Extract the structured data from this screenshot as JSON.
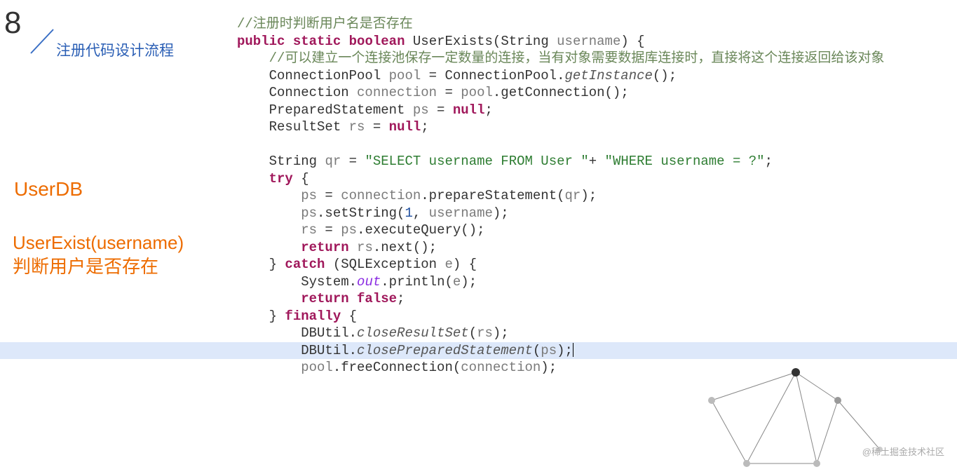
{
  "slide": {
    "number": "8",
    "title": "注册代码设计流程"
  },
  "sidebar": {
    "label1": "UserDB",
    "label2_line1": "UserExist(username)",
    "label2_line2": "判断用户是否存在"
  },
  "code": {
    "l1_cm": "//注册时判断用户名是否存在",
    "l2_kw1": "public",
    "l2_kw2": "static",
    "l2_kw3": "boolean",
    "l2_fn": "UserExists",
    "l2_p1": "(String ",
    "l2_v1": "username",
    "l2_p2": ") {",
    "l3_cm": "//可以建立一个连接池保存一定数量的连接，当有对象需要数据库连接时，直接将这个连接返回给该对象",
    "l4_a": "ConnectionPool ",
    "l4_v": "pool",
    "l4_b": " = ConnectionPool.",
    "l4_m": "getInstance",
    "l4_c": "();",
    "l5_a": "Connection ",
    "l5_v": "connection",
    "l5_b": " = ",
    "l5_v2": "pool",
    "l5_c": ".getConnection();",
    "l6_a": "PreparedStatement ",
    "l6_v": "ps",
    "l6_b": " = ",
    "l6_kw": "null",
    "l6_c": ";",
    "l7_a": "ResultSet ",
    "l7_v": "rs",
    "l7_b": " = ",
    "l7_kw": "null",
    "l7_c": ";",
    "l9_a": "String ",
    "l9_v": "qr",
    "l9_b": " = ",
    "l9_s1": "\"SELECT username FROM User \"",
    "l9_c": "+ ",
    "l9_s2": "\"WHERE username = ?\"",
    "l9_d": ";",
    "l10_kw": "try",
    "l10_a": " {",
    "l11_v": "ps",
    "l11_a": " = ",
    "l11_v2": "connection",
    "l11_b": ".prepareStatement(",
    "l11_v3": "qr",
    "l11_c": ");",
    "l12_v": "ps",
    "l12_a": ".setString(",
    "l12_n": "1",
    "l12_b": ", ",
    "l12_v2": "username",
    "l12_c": ");",
    "l13_v": "rs",
    "l13_a": " = ",
    "l13_v2": "ps",
    "l13_b": ".executeQuery();",
    "l14_kw": "return",
    "l14_a": " ",
    "l14_v": "rs",
    "l14_b": ".next();",
    "l15_a": "} ",
    "l15_kw": "catch",
    "l15_b": " (SQLException ",
    "l15_v": "e",
    "l15_c": ") {",
    "l16_a": "System.",
    "l16_s": "out",
    "l16_b": ".println(",
    "l16_v": "e",
    "l16_c": ");",
    "l17_kw": "return false",
    "l17_a": ";",
    "l18_a": "} ",
    "l18_kw": "finally",
    "l18_b": " {",
    "l19_a": "DBUtil.",
    "l19_m": "closeResultSet",
    "l19_b": "(",
    "l19_v": "rs",
    "l19_c": ");",
    "l20_a": "DBUtil.",
    "l20_m": "closePreparedStatement",
    "l20_b": "(",
    "l20_v": "ps",
    "l20_c": ");",
    "l21_v": "pool",
    "l21_a": ".freeConnection(",
    "l21_v2": "connection",
    "l21_b": ");"
  },
  "watermark": "@稀土掘金技术社区"
}
